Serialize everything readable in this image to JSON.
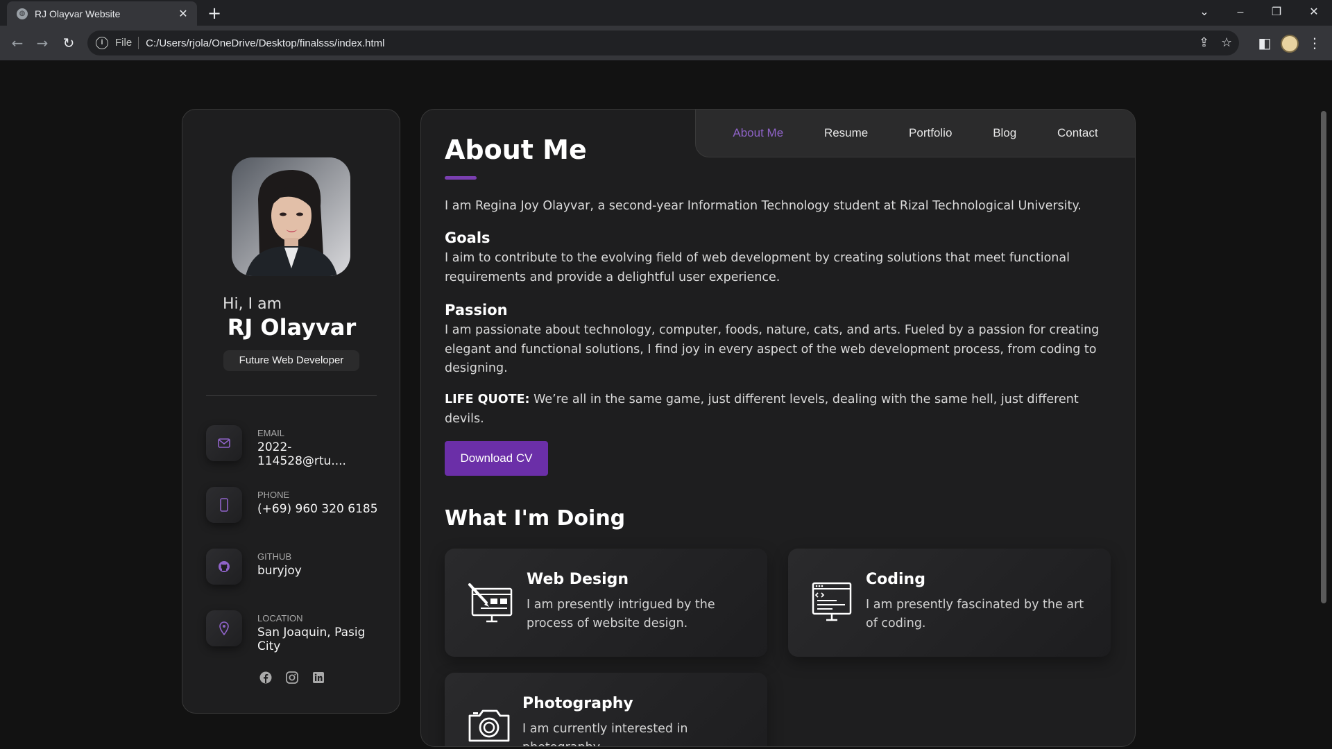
{
  "browser": {
    "tab_title": "RJ Olayvar Website",
    "url_scheme": "File",
    "url": "C:/Users/rjola/OneDrive/Desktop/finalsss/index.html"
  },
  "sidebar": {
    "greeting": "Hi, I am",
    "name": "RJ Olayvar",
    "role": "Future Web Developer",
    "contacts": [
      {
        "label": "EMAIL",
        "value": "2022-114528@rtu....",
        "icon": "mail-icon"
      },
      {
        "label": "PHONE",
        "value": "(+69) 960 320 6185",
        "icon": "phone-icon"
      },
      {
        "label": "GITHUB",
        "value": "buryjoy",
        "icon": "github-icon"
      },
      {
        "label": "LOCATION",
        "value": "San Joaquin, Pasig City",
        "icon": "location-pin-icon"
      }
    ],
    "socials": [
      "facebook-icon",
      "instagram-icon",
      "linkedin-icon"
    ]
  },
  "nav": {
    "items": [
      "About Me",
      "Resume",
      "Portfolio",
      "Blog",
      "Contact"
    ],
    "active": "About Me"
  },
  "about": {
    "heading": "About Me",
    "intro": "I am Regina Joy Olayvar, a second-year Information Technology student at Rizal Technological University.",
    "goals_heading": "Goals",
    "goals_text": "I aim to contribute to the evolving field of web development by creating solutions that meet functional requirements and provide a delightful user experience.",
    "passion_heading": "Passion",
    "passion_text": "I am passionate about technology, computer, foods, nature, cats, and arts. Fueled by a passion for creating elegant and functional solutions, I find joy in every aspect of the web development process, from coding to designing.",
    "quote_label": "LIFE QUOTE:",
    "quote_text": "We’re all in the same game, just different levels, dealing with the same hell, just different devils.",
    "cv_button": "Download CV"
  },
  "doing": {
    "heading": "What I'm Doing",
    "services": [
      {
        "title": "Web Design",
        "text": "I am presently intrigued by the process of website design.",
        "icon": "web-design-icon"
      },
      {
        "title": "Coding",
        "text": "I am presently fascinated by the art of coding.",
        "icon": "code-window-icon"
      },
      {
        "title": "Photography",
        "text": "I am currently interested in photography.",
        "icon": "camera-icon"
      }
    ]
  },
  "colors": {
    "accent": "#7a3fb0",
    "button": "#6b2fa8",
    "nav_active": "#8f63c8",
    "card_bg": "#1e1e1f",
    "page_bg": "#121212"
  }
}
